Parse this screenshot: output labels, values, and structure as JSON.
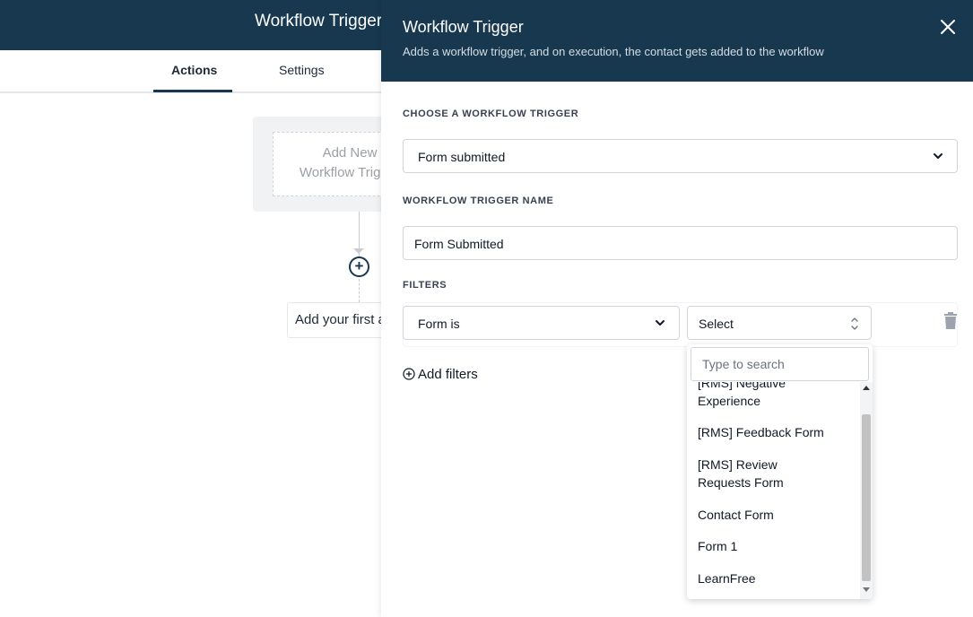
{
  "app": {
    "header_title": "Workflow Trigger",
    "tabs": [
      {
        "label": "Actions"
      },
      {
        "label": "Settings"
      }
    ],
    "trigger_card_text": "Add New Workflow Trigger",
    "first_action_text": "Add your first action"
  },
  "panel": {
    "title": "Workflow Trigger",
    "description": "Adds a workflow trigger, and on execution, the contact gets added to the workflow",
    "choose_label": "CHOOSE A WORKFLOW TRIGGER",
    "trigger_value": "Form submitted",
    "name_label": "WORKFLOW TRIGGER NAME",
    "name_value": "Form Submitted",
    "filters_label": "FILTERS",
    "filter_field": "Form is",
    "filter_value": "Select",
    "add_filters": "Add filters"
  },
  "dropdown": {
    "search_placeholder": "Type to search",
    "options": [
      "[RMS] Negative Experience",
      "[RMS] Feedback Form",
      "[RMS] Review Requests Form",
      "Contact Form",
      "Form 1",
      "LearnFree"
    ]
  },
  "colors": {
    "header": "#17384f",
    "accent": "#17384f"
  }
}
